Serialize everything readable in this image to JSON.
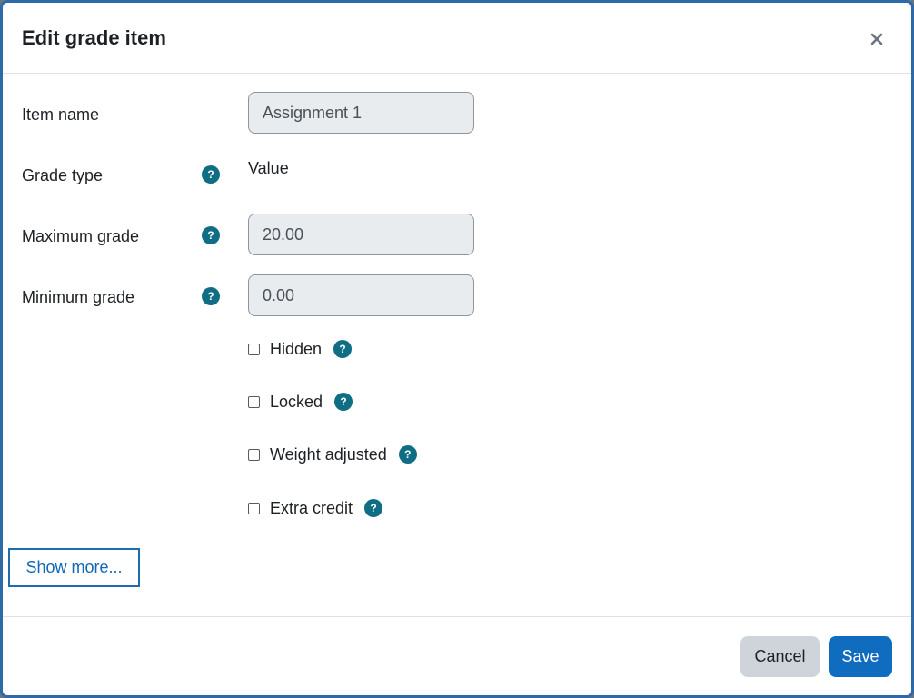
{
  "dialog": {
    "title": "Edit grade item",
    "close_icon": "close-icon"
  },
  "form": {
    "item_name": {
      "label": "Item name",
      "value": "Assignment 1"
    },
    "grade_type": {
      "label": "Grade type",
      "value": "Value",
      "help_icon": "question-icon"
    },
    "maximum_grade": {
      "label": "Maximum grade",
      "value": "20.00",
      "help_icon": "question-icon"
    },
    "minimum_grade": {
      "label": "Minimum grade",
      "value": "0.00",
      "help_icon": "question-icon"
    },
    "checkboxes": [
      {
        "label": "Hidden",
        "checked": false
      },
      {
        "label": "Locked",
        "checked": false
      },
      {
        "label": "Weight adjusted",
        "checked": false
      },
      {
        "label": "Extra credit",
        "checked": false
      }
    ],
    "help_glyph": "?",
    "show_more_label": "Show more..."
  },
  "footer": {
    "cancel_label": "Cancel",
    "save_label": "Save"
  },
  "colors": {
    "accent": "#0f6cbf",
    "help_icon": "#0f6e84",
    "border_focus": "#1f6bb0"
  }
}
